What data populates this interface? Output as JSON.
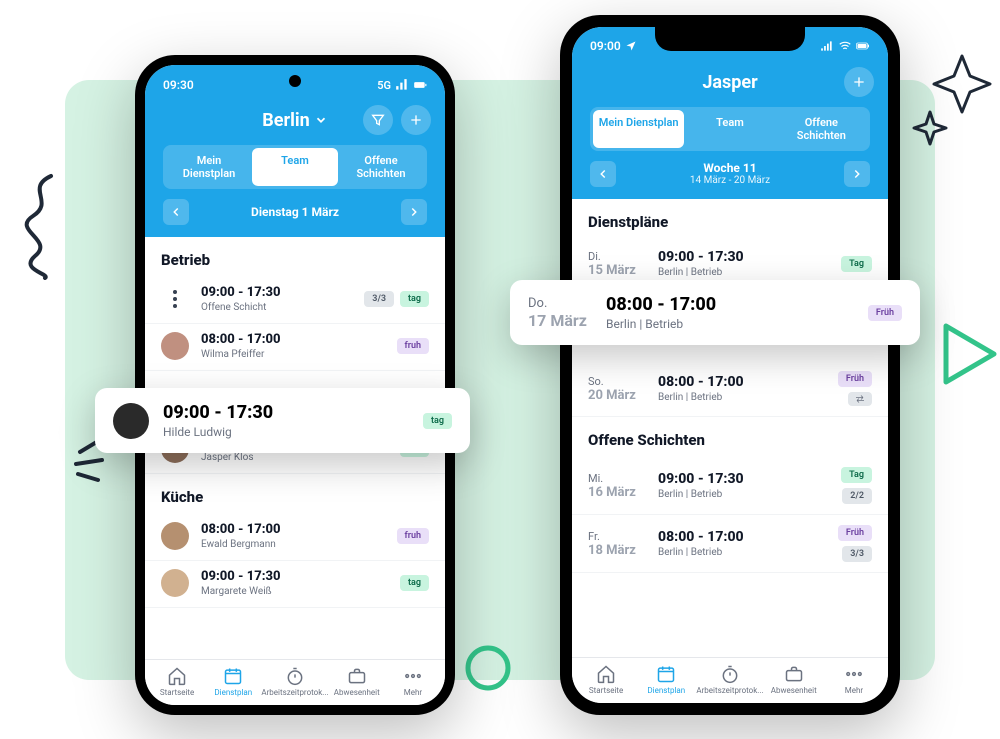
{
  "colors": {
    "primary": "#1ea5e8",
    "mint": "#d5f2e3"
  },
  "android": {
    "status_time": "09:30",
    "status_net": "5G",
    "title": "Berlin",
    "segments": [
      "Mein Dienstplan",
      "Team",
      "Offene Schichten"
    ],
    "active_segment": 1,
    "date_label": "Dienstag 1 März",
    "sections": [
      {
        "title": "Betrieb",
        "items": [
          {
            "kind": "open",
            "time": "09:00 - 17:30",
            "sub": "Offene Schicht",
            "count": "3/3",
            "tag": "tag",
            "tag_color": "green"
          },
          {
            "kind": "person",
            "time": "08:00 - 17:00",
            "sub": "Wilma Pfeiffer",
            "tag": "fruh",
            "tag_color": "purple"
          },
          {
            "kind": "person",
            "time": "09:00 - 17:30",
            "sub": "Jasper Klos",
            "tag": "tag",
            "tag_color": "green"
          }
        ]
      },
      {
        "title": "Küche",
        "items": [
          {
            "kind": "person",
            "time": "08:00 - 17:00",
            "sub": "Ewald Bergmann",
            "tag": "fruh",
            "tag_color": "purple"
          },
          {
            "kind": "person",
            "time": "09:00 - 17:30",
            "sub": "Margarete Weiß",
            "tag": "tag",
            "tag_color": "green"
          }
        ]
      }
    ],
    "popout": {
      "time": "09:00 - 17:30",
      "sub": "Hilde Ludwig",
      "tag": "tag"
    }
  },
  "ios": {
    "status_time": "09:00",
    "title": "Jasper",
    "segments": [
      "Mein Dienstplan",
      "Team",
      "Offene Schichten"
    ],
    "active_segment": 0,
    "week_title": "Woche 11",
    "week_range": "14 März - 20 März",
    "sections": [
      {
        "title": "Dienstpläne",
        "items": [
          {
            "dow": "Di.",
            "day": "15 März",
            "time": "09:00 - 17:30",
            "sub": "Berlin | Betrieb",
            "tag": "Tag",
            "tag_color": "green"
          },
          {
            "dow": "So.",
            "day": "20 März",
            "time": "08:00 - 17:00",
            "sub": "Berlin | Betrieb",
            "tag": "Früh",
            "tag_color": "purple",
            "swap": true
          }
        ]
      },
      {
        "title": "Offene Schichten",
        "items": [
          {
            "dow": "Mi.",
            "day": "16 März",
            "time": "09:00 - 17:30",
            "sub": "Berlin | Betrieb",
            "tag": "Tag",
            "tag_color": "green",
            "count": "2/2"
          },
          {
            "dow": "Fr.",
            "day": "18 März",
            "time": "08:00 - 17:00",
            "sub": "Berlin | Betrieb",
            "tag": "Früh",
            "tag_color": "purple",
            "count": "3/3"
          }
        ]
      }
    ],
    "popout": {
      "dow": "Do.",
      "day": "17 März",
      "time": "08:00 - 17:00",
      "sub": "Berlin | Betrieb",
      "tag": "Früh"
    }
  },
  "tabs": [
    {
      "icon": "home",
      "label": "Startseite"
    },
    {
      "icon": "cal",
      "label": "Dienstplan"
    },
    {
      "icon": "timer",
      "label": "Arbeitszeitprotok..."
    },
    {
      "icon": "brief",
      "label": "Abwesenheit"
    },
    {
      "icon": "more",
      "label": "Mehr"
    }
  ],
  "active_tab": 1
}
